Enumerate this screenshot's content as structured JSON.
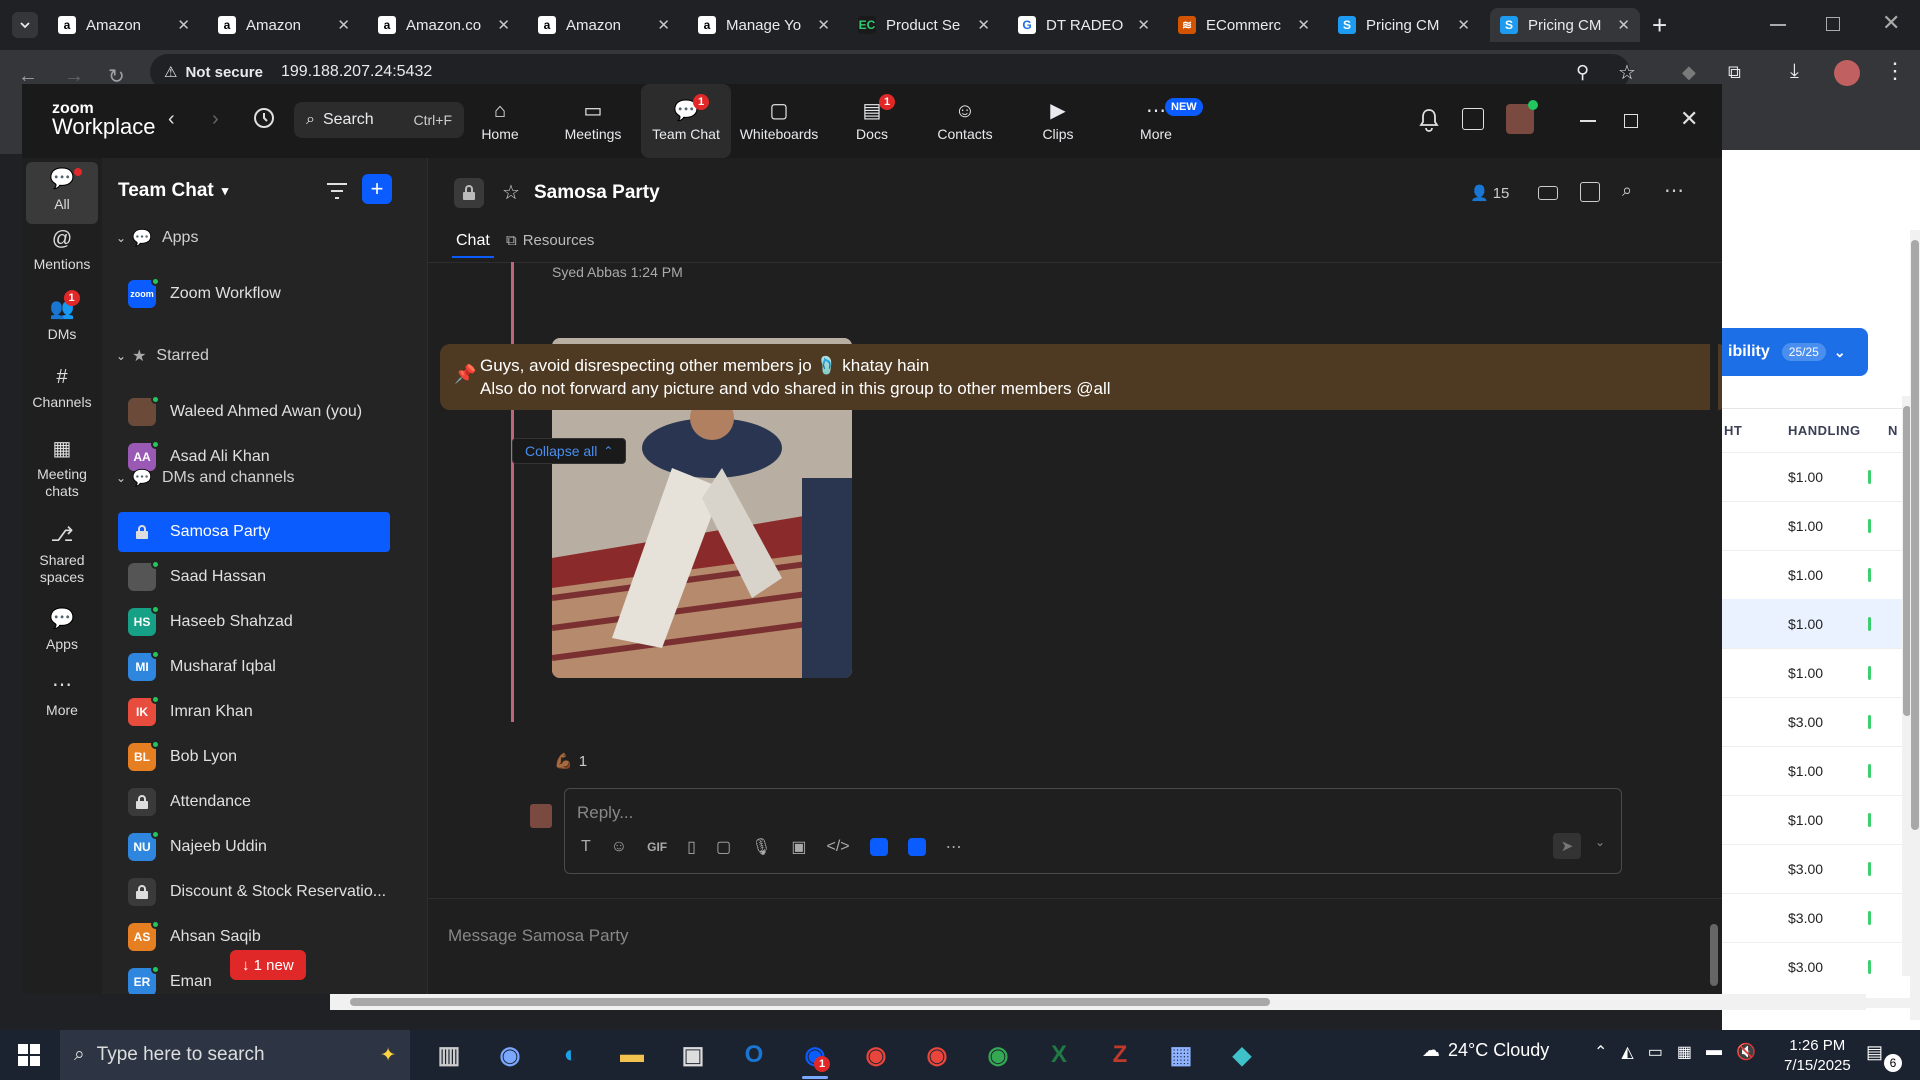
{
  "browser": {
    "tabs": [
      {
        "title": "Amazon",
        "icon": "amazon-icon"
      },
      {
        "title": "Amazon",
        "icon": "amazon-icon"
      },
      {
        "title": "Amazon.co",
        "icon": "amazon-icon"
      },
      {
        "title": "Amazon",
        "icon": "amazon-icon"
      },
      {
        "title": "Manage Yo",
        "icon": "amazon-icon"
      },
      {
        "title": "Product Se",
        "icon": "ec-icon"
      },
      {
        "title": "DT RADEO",
        "icon": "dt-icon"
      },
      {
        "title": "ECommerc",
        "icon": "ecommerce-icon"
      },
      {
        "title": "Pricing CM",
        "icon": "pricing-icon"
      },
      {
        "title": "Pricing CM",
        "icon": "pricing-icon"
      }
    ],
    "security_label": "Not secure",
    "url": "199.188.207.24:5432"
  },
  "zoom": {
    "logo_top": "zoom",
    "logo_bottom": "Workplace",
    "search_label": "Search",
    "search_shortcut": "Ctrl+F",
    "nav": [
      {
        "label": "Home",
        "badge": ""
      },
      {
        "label": "Meetings",
        "badge": ""
      },
      {
        "label": "Team Chat",
        "badge": "1"
      },
      {
        "label": "Whiteboards",
        "badge": ""
      },
      {
        "label": "Docs",
        "badge": "1"
      },
      {
        "label": "Contacts",
        "badge": ""
      },
      {
        "label": "Clips",
        "badge": ""
      },
      {
        "label": "More",
        "badge": "NEW"
      }
    ],
    "rail": [
      {
        "label": "All",
        "badge": ""
      },
      {
        "label": "Mentions",
        "badge": ""
      },
      {
        "label": "DMs",
        "badge": "1"
      },
      {
        "label": "Channels",
        "badge": ""
      },
      {
        "label": "Meeting chats",
        "badge": ""
      },
      {
        "label": "Shared spaces",
        "badge": ""
      },
      {
        "label": "Apps",
        "badge": ""
      },
      {
        "label": "More",
        "badge": ""
      }
    ],
    "panel_title": "Team Chat",
    "sections": {
      "apps": "Apps",
      "starred": "Starred",
      "dms": "DMs and channels"
    },
    "apps": [
      {
        "name": "Zoom Workflow",
        "initials": "zoom",
        "color": "#0b5cff"
      }
    ],
    "starred": [
      {
        "name": "Waleed Ahmed Awan (you)",
        "initials": "",
        "color": "#6b4a3a"
      },
      {
        "name": "Asad Ali Khan",
        "initials": "AA",
        "color": "#9b59b6"
      }
    ],
    "channels": [
      {
        "name": "Samosa Party",
        "initials": "",
        "color": "",
        "type": "lock",
        "active": true
      },
      {
        "name": "Saad Hassan",
        "initials": "",
        "color": "#555555",
        "type": "photo"
      },
      {
        "name": "Haseeb Shahzad",
        "initials": "HS",
        "color": "#16a085",
        "type": "avatar"
      },
      {
        "name": "Musharaf Iqbal",
        "initials": "MI",
        "color": "#2e86de",
        "type": "avatar"
      },
      {
        "name": "Imran Khan",
        "initials": "IK",
        "color": "#e74c3c",
        "type": "avatar"
      },
      {
        "name": "Bob Lyon",
        "initials": "BL",
        "color": "#e67e22",
        "type": "avatar"
      },
      {
        "name": "Attendance",
        "initials": "",
        "color": "#3a3a3a",
        "type": "lock"
      },
      {
        "name": "Najeeb Uddin",
        "initials": "NU",
        "color": "#2e86de",
        "type": "avatar"
      },
      {
        "name": "Discount & Stock Reservatio...",
        "initials": "",
        "color": "#3a3a3a",
        "type": "lock"
      },
      {
        "name": "Ahsan Saqib",
        "initials": "AS",
        "color": "#e67e22",
        "type": "avatar"
      },
      {
        "name": "Eman",
        "initials": "ER",
        "color": "#2e86de",
        "type": "avatar"
      }
    ],
    "new_badge": "↓ 1 new",
    "channel_title": "Samosa Party",
    "member_count": "15",
    "tabs": {
      "chat": "Chat",
      "resources": "Resources"
    },
    "sender_line": "Syed Abbas 1:24 PM",
    "pinned_line1": "Guys, avoid disrespecting other members jo 🩴 khatay hain",
    "pinned_line2": "Also do not forward any picture and vdo shared in this group to other members @all",
    "collapse_label": "Collapse all",
    "reaction_emoji": "💪🏾",
    "reaction_count": "1",
    "reply_placeholder": "Reply...",
    "composer_placeholder": "Message Samosa Party"
  },
  "bgpage": {
    "button_label": "ibility",
    "button_count": "25/25",
    "col_a": "HT",
    "col_b": "HANDLING",
    "col_c": "N",
    "values": [
      "$1.00",
      "$1.00",
      "$1.00",
      "$1.00",
      "$1.00",
      "$3.00",
      "$1.00",
      "$1.00",
      "$3.00",
      "$3.00",
      "$3.00"
    ]
  },
  "taskbar": {
    "search_placeholder": "Type here to search",
    "weather": "24°C Cloudy",
    "time": "1:26 PM",
    "date": "7/15/2025",
    "notif_count": "6",
    "zoom_badge": "1"
  }
}
